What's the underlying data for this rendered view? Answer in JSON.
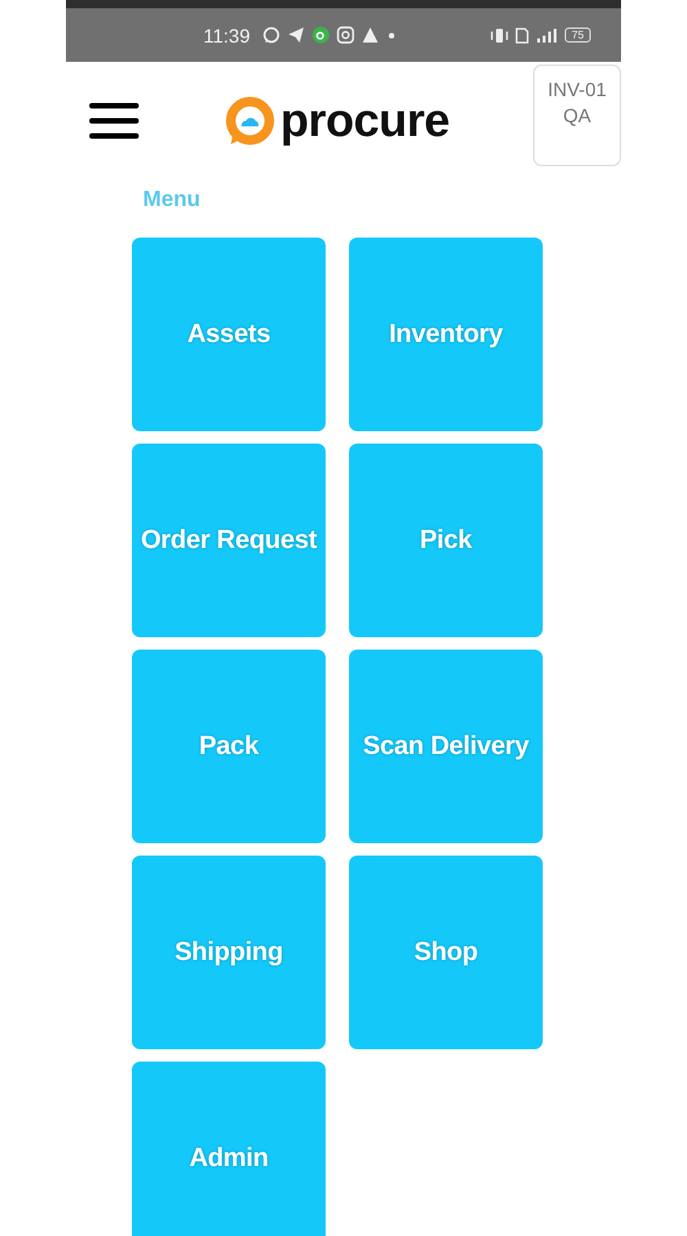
{
  "status_bar": {
    "time": "11:39",
    "battery": "75"
  },
  "header": {
    "logo_text": "procure",
    "badge": [
      "INV-01",
      "QA"
    ]
  },
  "menu": {
    "title": "Menu",
    "tiles": [
      {
        "label": "Assets"
      },
      {
        "label": "Inventory"
      },
      {
        "label": "Order Request"
      },
      {
        "label": "Pick"
      },
      {
        "label": "Pack"
      },
      {
        "label": "Scan Delivery"
      },
      {
        "label": "Shipping"
      },
      {
        "label": "Shop"
      },
      {
        "label": "Admin"
      }
    ]
  }
}
